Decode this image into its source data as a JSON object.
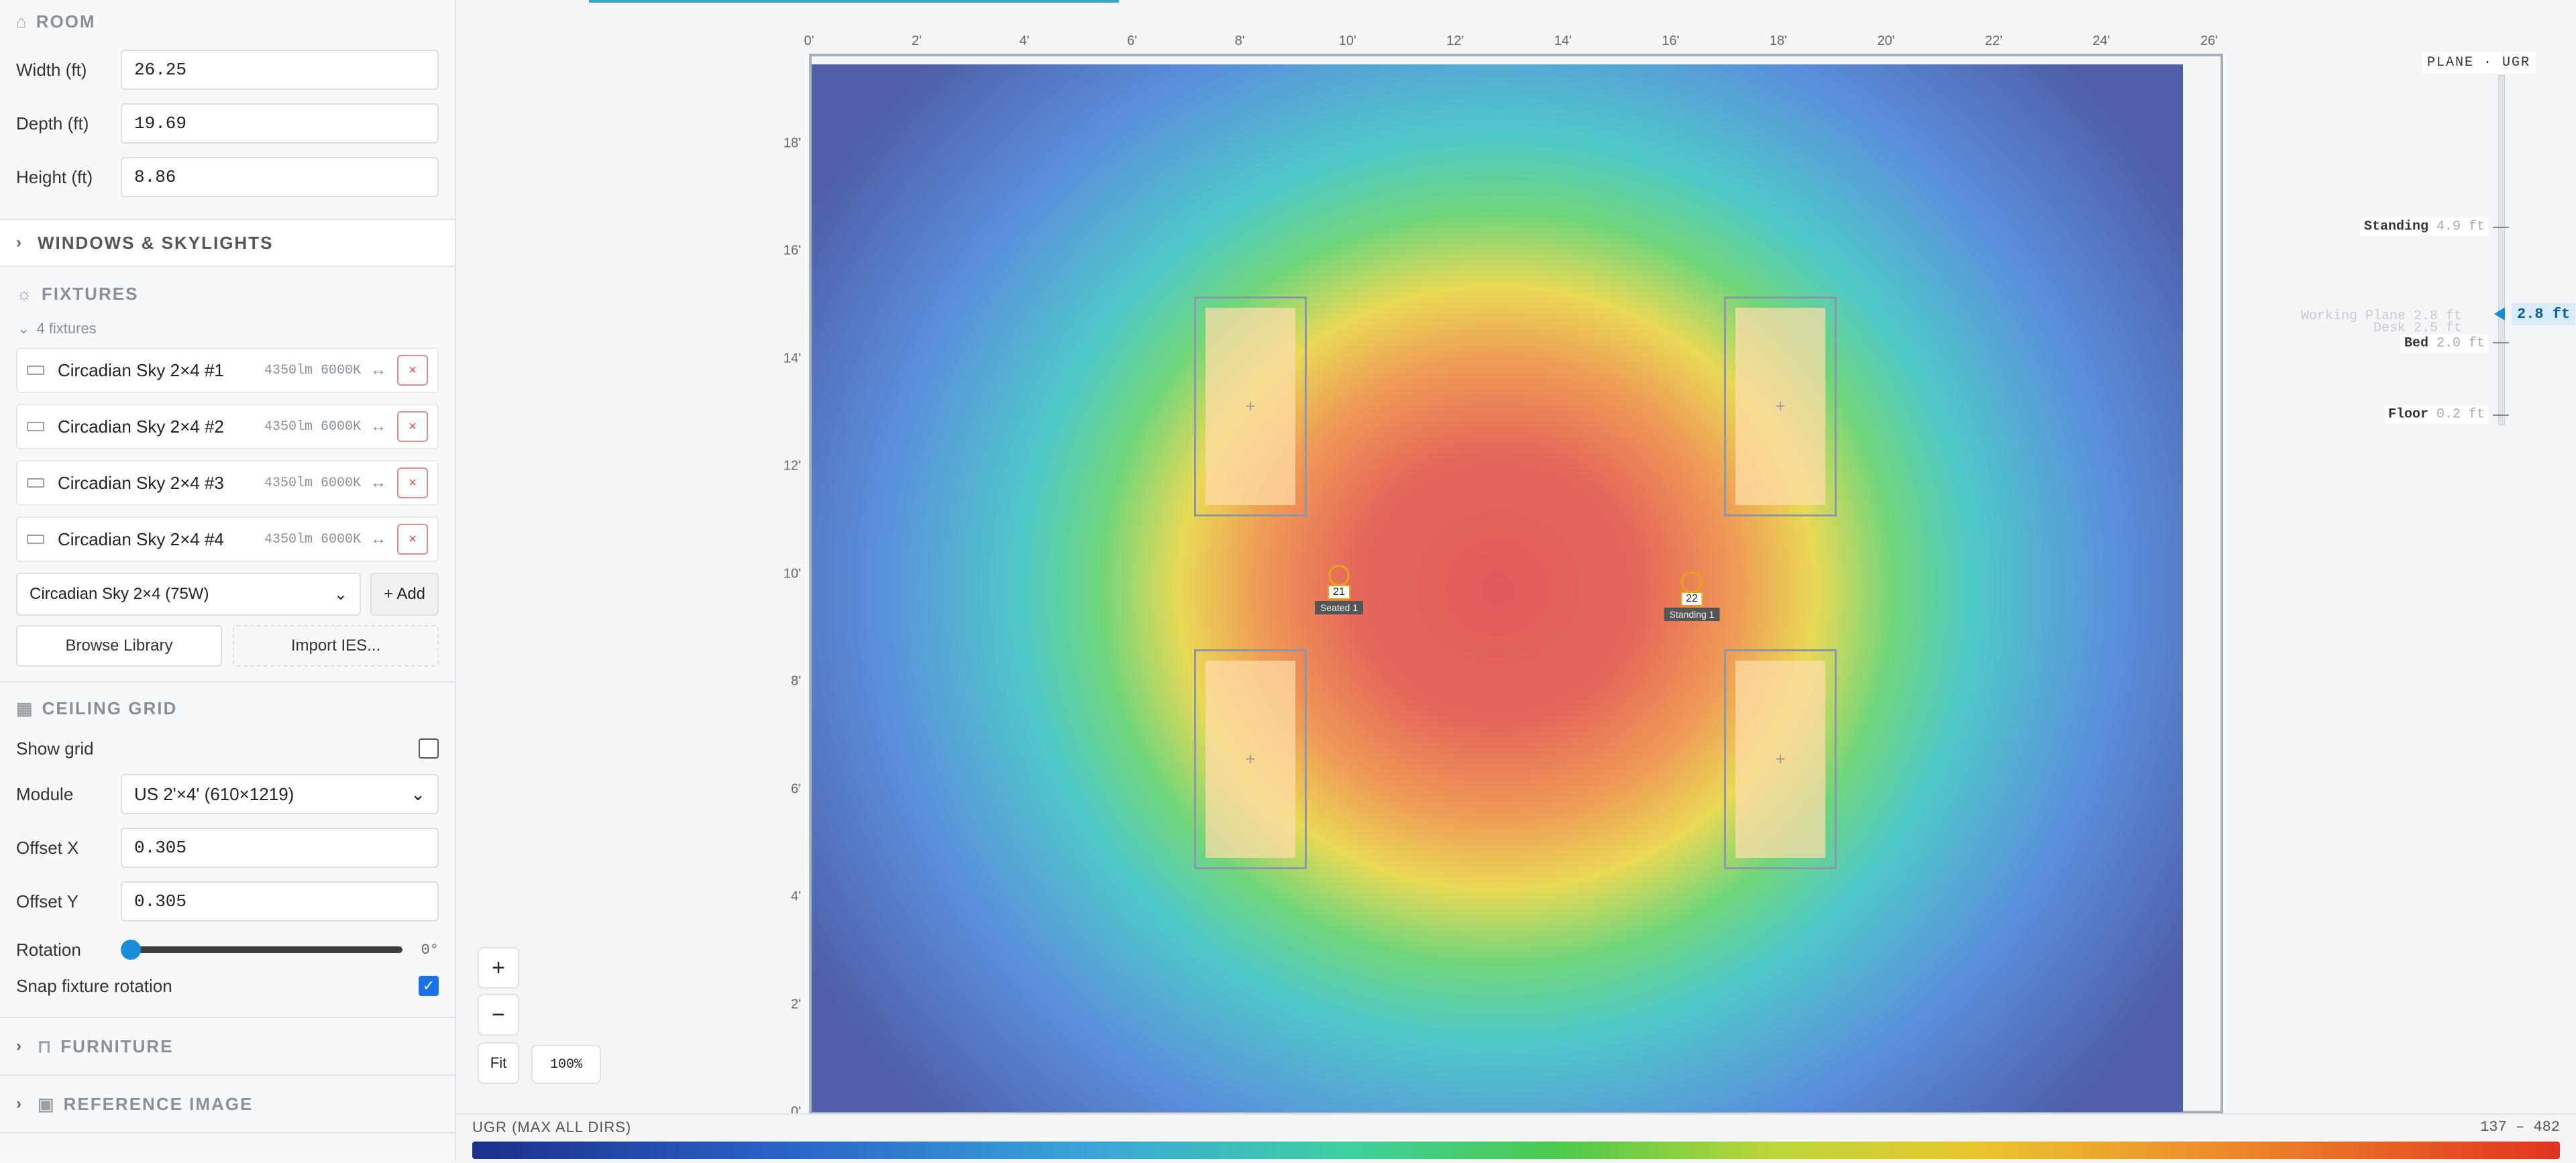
{
  "room": {
    "title": "ROOM",
    "width_label": "Width (ft)",
    "width_value": "26.25",
    "depth_label": "Depth (ft)",
    "depth_value": "19.69",
    "height_label": "Height (ft)",
    "height_value": "8.86"
  },
  "windows": {
    "title": "WINDOWS & SKYLIGHTS"
  },
  "fixtures": {
    "title": "FIXTURES",
    "count": "4 fixtures",
    "items": [
      {
        "name": "Circadian Sky 2×4 #1",
        "meta": "4350lm 6000K"
      },
      {
        "name": "Circadian Sky 2×4 #2",
        "meta": "4350lm 6000K"
      },
      {
        "name": "Circadian Sky 2×4 #3",
        "meta": "4350lm 6000K"
      },
      {
        "name": "Circadian Sky 2×4 #4",
        "meta": "4350lm 6000K"
      }
    ],
    "delete_glyph": "×",
    "swap_glyph": "↔",
    "selected_model": "Circadian Sky 2×4 (75W)",
    "add_label": "+ Add",
    "browse_label": "Browse Library",
    "import_label": "Import IES..."
  },
  "ceiling": {
    "title": "CEILING GRID",
    "show_grid_label": "Show grid",
    "module_label": "Module",
    "module_value": "US 2'×4' (610×1219)",
    "offset_x_label": "Offset X",
    "offset_x_value": "0.305",
    "offset_y_label": "Offset Y",
    "offset_y_value": "0.305",
    "rotation_label": "Rotation",
    "rotation_value": "0°",
    "snap_label": "Snap fixture rotation",
    "snap_checked": true,
    "show_grid_checked": false
  },
  "furniture": {
    "title": "FURNITURE"
  },
  "reference": {
    "title": "REFERENCE IMAGE"
  },
  "canvas": {
    "x_ticks": [
      "0'",
      "2'",
      "4'",
      "6'",
      "8'",
      "10'",
      "12'",
      "14'",
      "16'",
      "18'",
      "20'",
      "22'",
      "24'",
      "26'"
    ],
    "y_ticks": [
      "18'",
      "16'",
      "14'",
      "12'",
      "10'",
      "8'",
      "6'",
      "4'",
      "2'",
      "0'"
    ],
    "fixtures": [
      {
        "id": "fixture-1"
      },
      {
        "id": "fixture-2"
      },
      {
        "id": "fixture-3"
      },
      {
        "id": "fixture-4"
      }
    ],
    "observers": [
      {
        "value": "21",
        "label": "Seated 1"
      },
      {
        "value": "22",
        "label": "Standing 1"
      }
    ],
    "zoom_in": "+",
    "zoom_out": "−",
    "fit": "Fit",
    "zoom_pct": "100%"
  },
  "plane": {
    "title": "PLANE · UGR",
    "levels": [
      {
        "name": "Standing",
        "value": "4.9 ft"
      },
      {
        "name": "Bed",
        "value": "2.0 ft"
      },
      {
        "name": "Floor",
        "value": "0.2 ft"
      }
    ],
    "ghost_label": "Working Plane 2.8 ft",
    "ghost_label2": "Desk 2.5 ft",
    "active_value": "2.8 ft"
  },
  "legend": {
    "title": "UGR (MAX ALL DIRS)",
    "range": "137 – 482"
  },
  "icons": {
    "room": "home-icon",
    "fixtures": "sun-icon",
    "grid": "grid-icon",
    "furniture": "sofa-icon",
    "reference": "image-icon"
  }
}
